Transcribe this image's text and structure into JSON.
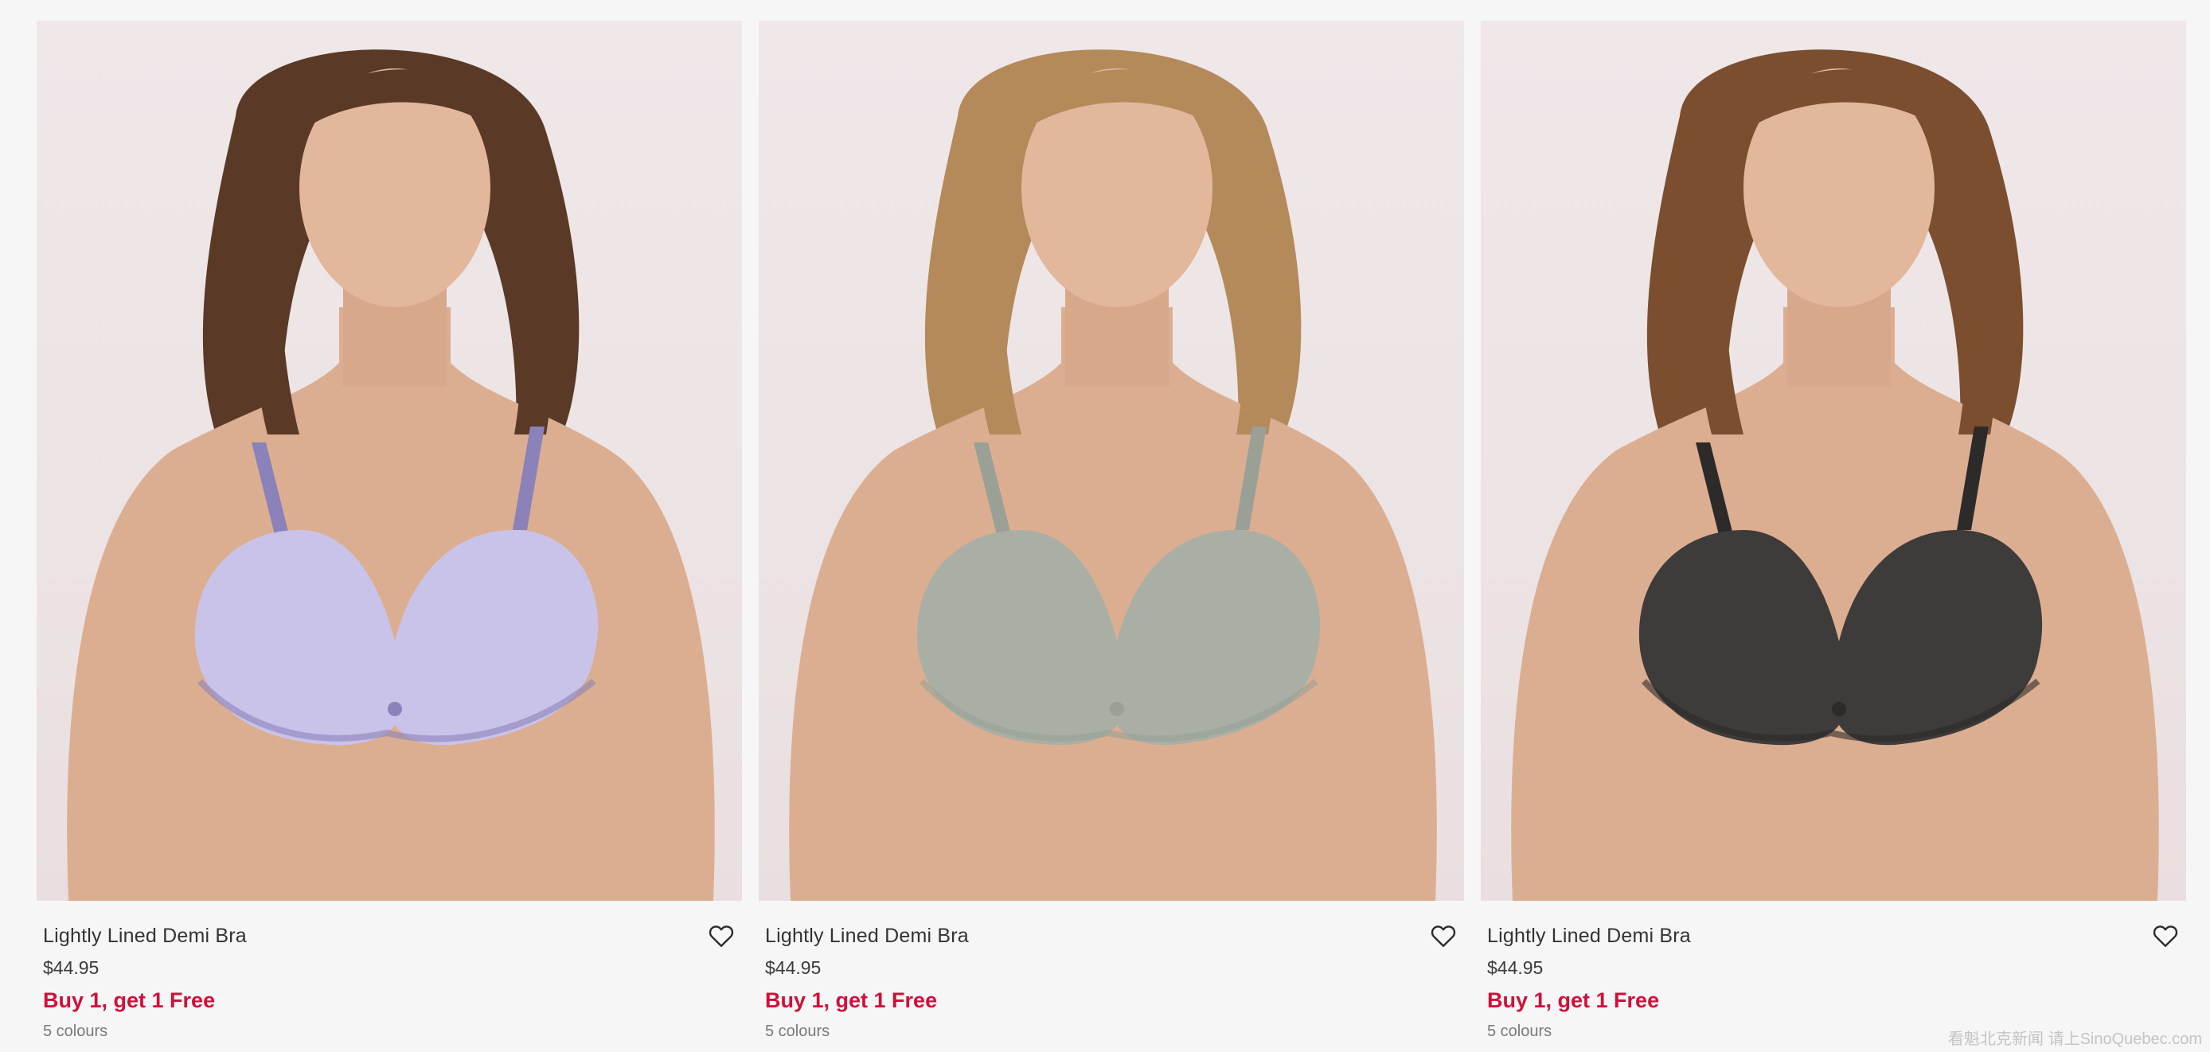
{
  "colors": {
    "promo": "#d0103a",
    "background": "#f6f6f6"
  },
  "products": [
    {
      "name": "Lightly Lined Demi Bra",
      "price": "$44.95",
      "promo": "Buy 1, get 1 Free",
      "colours": "5 colours",
      "bra_color": "#c9c3ea",
      "strap_color": "#8a82b8",
      "hair_color": "#5a3a26",
      "wishlist_icon": "heart-outline-icon"
    },
    {
      "name": "Lightly Lined Demi Bra",
      "price": "$44.95",
      "promo": "Buy 1, get 1 Free",
      "colours": "5 colours",
      "bra_color": "#a9afa5",
      "strap_color": "#9aa096",
      "hair_color": "#b58a5a",
      "wishlist_icon": "heart-outline-icon"
    },
    {
      "name": "Lightly Lined Demi Bra",
      "price": "$44.95",
      "promo": "Buy 1, get 1 Free",
      "colours": "5 colours",
      "bra_color": "#3e3b3b",
      "strap_color": "#2d2a2a",
      "hair_color": "#7a4e2e",
      "wishlist_icon": "heart-outline-icon"
    }
  ],
  "watermark": "看魁北克新闻 请上SinoQuebec.com"
}
